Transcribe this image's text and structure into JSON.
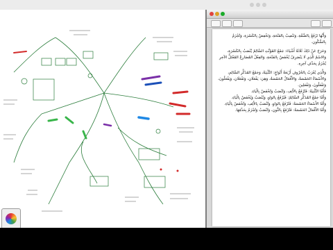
{
  "document": {
    "paragraphs": [
      [
        "وَأَنَّهَا تَرْفَعُ بِالضَّمَّةِ، وَتَنْصِبُ بِالفَتْحَةِ، وَتَخْفِضُ بِالكَسْرَةِ، وَتُجْزَمُ بِالسُّكُونِ."
      ],
      [
        "وَخَرَجَ عَنْ ذَلِكَ ثَلَاثَةُ أَشْيَاءَ: جَمْعُ المُؤَنَّثِ السَّالِمُ يُنْصَبُ بِالكَسْرَةِ،",
        "وَالاسْمُ الَّذِي لَا يَنْصَرِفُ يُخْفَضُ بِالفَتْحَةِ، وَالفِعْلُ المُضَارِعُ المُعْتَلُّ الآخِرِ",
        "يُجْزَمُ بِحَذْفِ آخِرِهِ."
      ],
      [
        "وَالَّذِي يُعْرَبُ بِالحُرُوفِ أَرْبَعَةُ أَنْوَاعٍ: التَّثْنِيَةُ، وَجَمْعُ المُذَكَّرِ السَّالِمِ،",
        "وَالأَسْمَاءُ الخَمْسَةُ، وَالأَفْعَالُ الخَمْسَةُ، وَهِيَ: يَفْعَلَانِ، وَتَفْعَلَانِ،",
        "وَيَفْعَلُونَ، وَتَفْعَلُونَ، وَتَفْعَلِينَ."
      ],
      [
        "فَأَمَّا التَّثْنِيَةُ: فَتُرْفَعُ بِالأَلِفِ، وَتُنْصَبُ وَتُخْفَضُ بِالْيَاءِ."
      ],
      [
        "وَأَمَّا جَمْعُ المُذَكَّرِ السَّالِمُ: فَيُرْفَعُ بِالوَاوِ، وَيُنْصَبُ وَيُخْفَضُ بِالْيَاءِ."
      ],
      [
        "وَأَمَّا الأَسْمَاءُ الخَمْسَةُ: فَتُرْفَعُ بِالوَاوِ، وَتُنْصَبُ بِالأَلِفِ، وَتُخْفَضُ بِالْيَاءِ."
      ],
      [
        "وَأَمَّا الأَفْعَالُ الخَمْسَةُ: فَتُرْفَعُ بِالنُّونِ، وَتُنْصَبُ وَتُجْزَمُ بِحَذْفِهَا."
      ]
    ]
  },
  "colors": {
    "ink_green": "#2a7c3a",
    "ink_blue": "#1b4fb8",
    "ink_red": "#d22a2a",
    "ink_purple": "#7a2fa8",
    "ink_gray": "#555555"
  }
}
